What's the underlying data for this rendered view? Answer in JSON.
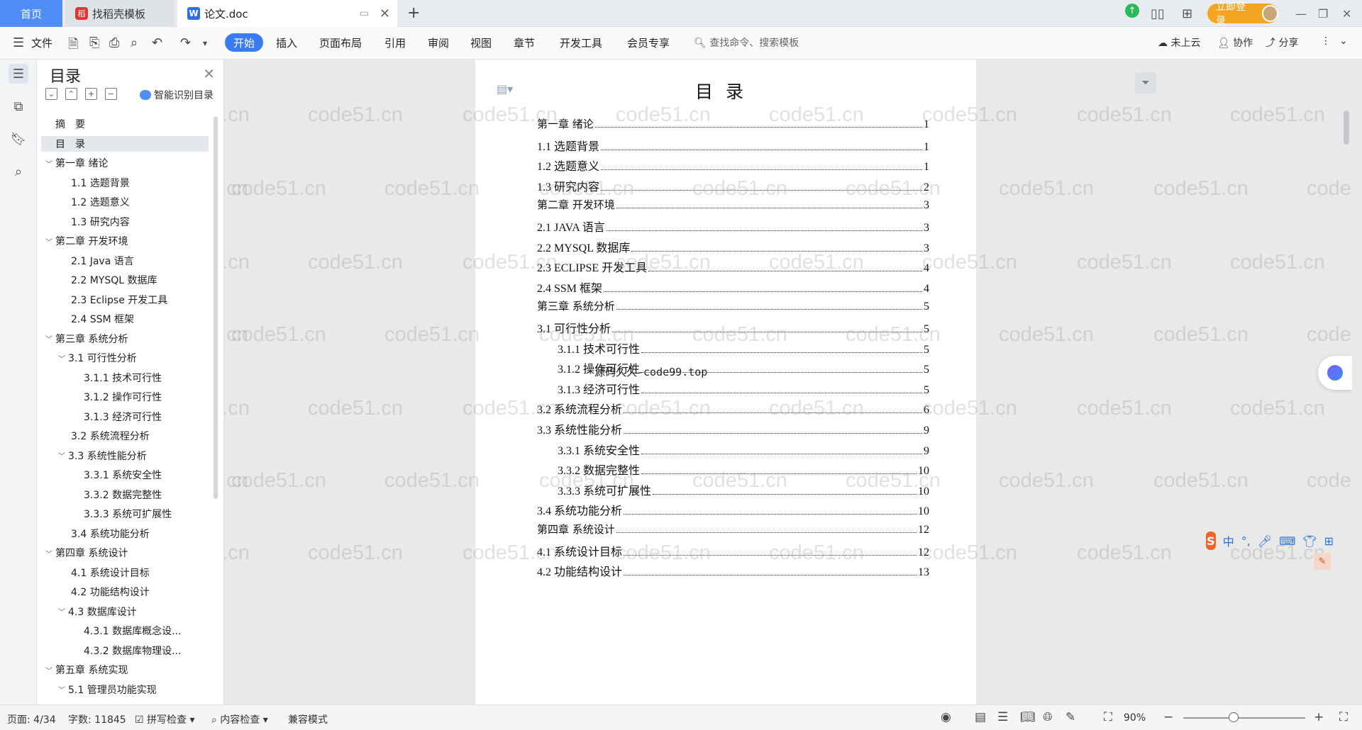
{
  "titlebar": {
    "tabs": [
      {
        "label": "首页"
      },
      {
        "label": "找稻壳模板"
      },
      {
        "label": "论文.doc"
      }
    ],
    "login_label": "立即登录"
  },
  "ribbon": {
    "file_label": "文件",
    "menus": [
      "开始",
      "插入",
      "页面布局",
      "引用",
      "审阅",
      "视图",
      "章节",
      "开发工具",
      "会员专享"
    ],
    "search_placeholder": "查找命令、搜索模板",
    "cloud_label": "未上云",
    "collab_label": "协作",
    "share_label": "分享"
  },
  "toc_panel": {
    "title": "目录",
    "smart_label": "智能识别目录",
    "items": [
      {
        "label": "摘　要",
        "level": 1,
        "caret": false,
        "selected": false
      },
      {
        "label": "目　录",
        "level": 1,
        "caret": false,
        "selected": true
      },
      {
        "label": "第一章  绪论",
        "level": 1,
        "caret": true,
        "selected": false
      },
      {
        "label": "1.1  选题背景",
        "level": 2,
        "caret": false,
        "selected": false
      },
      {
        "label": "1.2  选题意义",
        "level": 2,
        "caret": false,
        "selected": false
      },
      {
        "label": "1.3  研究内容",
        "level": 2,
        "caret": false,
        "selected": false
      },
      {
        "label": "第二章  开发环境",
        "level": 1,
        "caret": true,
        "selected": false
      },
      {
        "label": "2.1 Java 语言",
        "level": 2,
        "caret": false,
        "selected": false
      },
      {
        "label": "2.2 MYSQL 数据库",
        "level": 2,
        "caret": false,
        "selected": false
      },
      {
        "label": "2.3 Eclipse 开发工具",
        "level": 2,
        "caret": false,
        "selected": false
      },
      {
        "label": "2.4 SSM 框架",
        "level": 2,
        "caret": false,
        "selected": false
      },
      {
        "label": "第三章  系统分析",
        "level": 1,
        "caret": true,
        "selected": false
      },
      {
        "label": "3.1 可行性分析",
        "level": 2,
        "caret": true,
        "selected": false
      },
      {
        "label": "3.1.1 技术可行性",
        "level": 3,
        "caret": false,
        "selected": false
      },
      {
        "label": "3.1.2 操作可行性",
        "level": 3,
        "caret": false,
        "selected": false
      },
      {
        "label": "3.1.3 经济可行性",
        "level": 3,
        "caret": false,
        "selected": false
      },
      {
        "label": "3.2 系统流程分析",
        "level": 2,
        "caret": false,
        "selected": false
      },
      {
        "label": "3.3 系统性能分析",
        "level": 2,
        "caret": true,
        "selected": false
      },
      {
        "label": "3.3.1 系统安全性",
        "level": 3,
        "caret": false,
        "selected": false
      },
      {
        "label": "3.3.2 数据完整性",
        "level": 3,
        "caret": false,
        "selected": false
      },
      {
        "label": "3.3.3 系统可扩展性",
        "level": 3,
        "caret": false,
        "selected": false
      },
      {
        "label": "3.4 系统功能分析",
        "level": 2,
        "caret": false,
        "selected": false
      },
      {
        "label": "第四章  系统设计",
        "level": 1,
        "caret": true,
        "selected": false
      },
      {
        "label": "4.1  系统设计目标",
        "level": 2,
        "caret": false,
        "selected": false
      },
      {
        "label": "4.2 功能结构设计",
        "level": 2,
        "caret": false,
        "selected": false
      },
      {
        "label": "4.3 数据库设计",
        "level": 2,
        "caret": true,
        "selected": false
      },
      {
        "label": "4.3.1  数据库概念设...",
        "level": 3,
        "caret": false,
        "selected": false
      },
      {
        "label": "4.3.2  数据库物理设...",
        "level": 3,
        "caret": false,
        "selected": false
      },
      {
        "label": "第五章  系统实现",
        "level": 1,
        "caret": true,
        "selected": false
      },
      {
        "label": "5.1 管理员功能实现",
        "level": 2,
        "caret": true,
        "selected": false
      }
    ]
  },
  "document": {
    "heading": "目录",
    "entries": [
      {
        "text": "第一章  绪论",
        "page": "1",
        "indent": 0,
        "chapter": true
      },
      {
        "text": "1.1  选题背景",
        "page": "1",
        "indent": 0,
        "chapter": false
      },
      {
        "text": "1.2  选题意义",
        "page": "1",
        "indent": 0,
        "chapter": false
      },
      {
        "text": "1.3  研究内容",
        "page": "2",
        "indent": 0,
        "chapter": false
      },
      {
        "text": "第二章  开发环境",
        "page": "3",
        "indent": 0,
        "chapter": true
      },
      {
        "text": "2.1 JAVA 语言",
        "page": "3",
        "indent": 0,
        "chapter": false
      },
      {
        "text": "2.2 MYSQL 数据库",
        "page": "3",
        "indent": 0,
        "chapter": false
      },
      {
        "text": "2.3 ECLIPSE 开发工具",
        "page": "4",
        "indent": 0,
        "chapter": false
      },
      {
        "text": "2.4 SSM 框架",
        "page": "4",
        "indent": 0,
        "chapter": false
      },
      {
        "text": "第三章  系统分析",
        "page": "5",
        "indent": 0,
        "chapter": true
      },
      {
        "text": "3.1 可行性分析",
        "page": "5",
        "indent": 0,
        "chapter": false
      },
      {
        "text": "3.1.1 技术可行性",
        "page": "5",
        "indent": 1,
        "chapter": false
      },
      {
        "text": "3.1.2 操作可行性",
        "page": "5",
        "indent": 1,
        "chapter": false
      },
      {
        "text": "3.1.3 经济可行性",
        "page": "5",
        "indent": 1,
        "chapter": false
      },
      {
        "text": "3.2 系统流程分析",
        "page": "6",
        "indent": 0,
        "chapter": false
      },
      {
        "text": "3.3 系统性能分析",
        "page": "9",
        "indent": 0,
        "chapter": false
      },
      {
        "text": "3.3.1 系统安全性",
        "page": "9",
        "indent": 1,
        "chapter": false
      },
      {
        "text": "3.3.2 数据完整性",
        "page": "10",
        "indent": 1,
        "chapter": false
      },
      {
        "text": "3.3.3 系统可扩展性",
        "page": "10",
        "indent": 1,
        "chapter": false
      },
      {
        "text": "3.4 系统功能分析",
        "page": "10",
        "indent": 0,
        "chapter": false
      },
      {
        "text": "第四章  系统设计",
        "page": "12",
        "indent": 0,
        "chapter": true
      },
      {
        "text": "4.1  系统设计目标",
        "page": "12",
        "indent": 0,
        "chapter": false
      },
      {
        "text": "4.2 功能结构设计",
        "page": "13",
        "indent": 0,
        "chapter": false
      }
    ],
    "source_watermark": "源码久久-code99.top"
  },
  "watermark_text": "code51.cn",
  "ime": {
    "label_zh": "中",
    "label_punct": "°,"
  },
  "statusbar": {
    "page": "页面: 4/34",
    "words": "字数: 11845",
    "spell": "拼写检查",
    "content_check": "内容检查",
    "compat": "兼容模式",
    "zoom": "90%",
    "zoom_level": 0.41
  },
  "colors": {
    "accent": "#3b7bf1",
    "home_tab": "#4f8ef7",
    "login": "#f5a524",
    "ime": "#f0642a"
  }
}
